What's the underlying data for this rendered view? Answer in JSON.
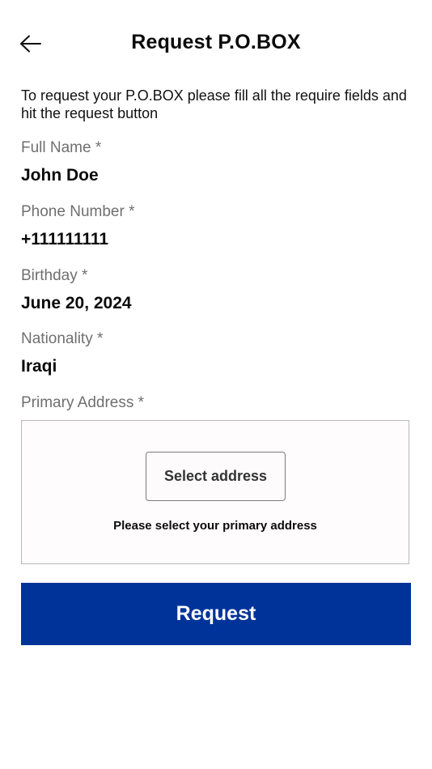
{
  "header": {
    "back_icon": "arrow-left-icon",
    "title": "Request P.O.BOX"
  },
  "intro": {
    "text": "To request your P.O.BOX please fill all the require fields and hit the request button"
  },
  "fields": {
    "full_name": {
      "label": "Full Name *",
      "value": "John Doe"
    },
    "phone_number": {
      "label": "Phone Number *",
      "value": "+111111111"
    },
    "birthday": {
      "label": "Birthday *",
      "value": "June 20, 2024"
    },
    "nationality": {
      "label": "Nationality *",
      "value": "Iraqi"
    }
  },
  "primary_address": {
    "label": "Primary Address *",
    "select_button_label": "Select address",
    "hint": "Please select your primary address"
  },
  "actions": {
    "request_label": "Request"
  },
  "colors": {
    "primary_button": "#003399",
    "label_gray": "#6f6f6f",
    "text": "#0b0b0b"
  }
}
